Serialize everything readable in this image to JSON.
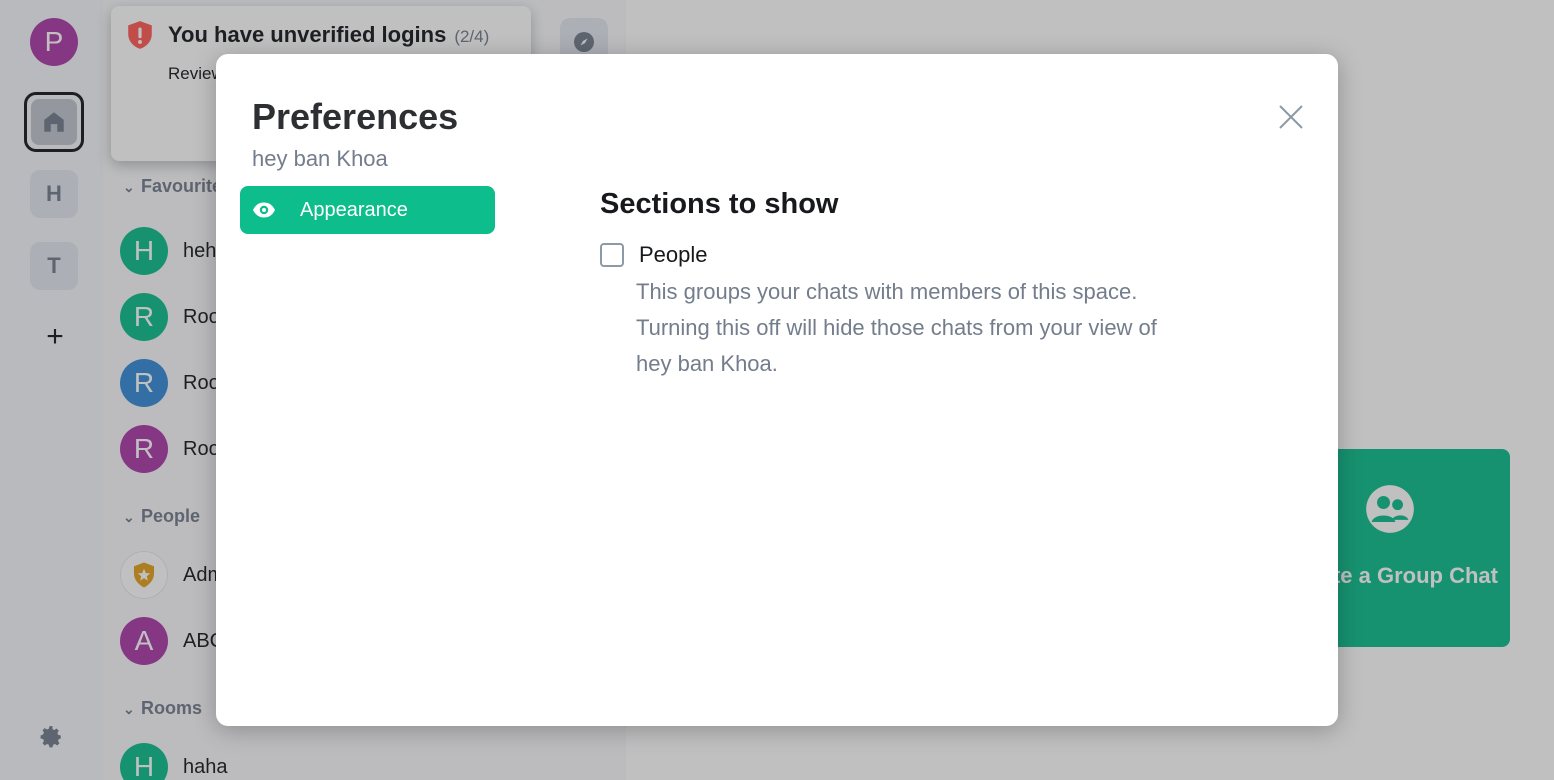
{
  "colors": {
    "accent": "#0dbd8b",
    "text_primary": "#17191c",
    "text_secondary": "#737d8c",
    "warning": "#ff5b55"
  },
  "space_bar": {
    "avatar_letter": "P",
    "home_icon": "home-icon",
    "spaces": [
      "H",
      "T"
    ],
    "add_symbol": "+",
    "settings_icon": "gear-icon"
  },
  "room_list": {
    "sections": [
      {
        "label": "Favourites",
        "rooms": [
          {
            "name": "hehe",
            "letter": "H",
            "color": "#0dbd8b"
          },
          {
            "name": "Room",
            "letter": "R",
            "color": "#0dbd8b"
          },
          {
            "name": "Room",
            "letter": "R",
            "color": "#2dc2c5"
          },
          {
            "name": "Room",
            "letter": "R",
            "color": "#ac3ba8"
          }
        ]
      },
      {
        "label": "People",
        "rooms": [
          {
            "name": "Admin",
            "letter": "",
            "color": "#fff"
          },
          {
            "name": "ABC",
            "letter": "A",
            "color": "#ac3ba8"
          }
        ]
      },
      {
        "label": "Rooms",
        "rooms": [
          {
            "name": "haha",
            "letter": "H",
            "color": "#0dbd8b"
          }
        ]
      }
    ]
  },
  "toast": {
    "title": "You have unverified logins",
    "count": "(2/4)",
    "body": "Review"
  },
  "main": {
    "create_group_label": "Create a Group Chat"
  },
  "dialog": {
    "title": "Preferences",
    "subtitle": "hey ban Khoa",
    "tabs": [
      {
        "label": "Appearance",
        "icon": "eye-icon",
        "selected": true
      }
    ],
    "section_heading": "Sections to show",
    "option": {
      "label": "People",
      "checked": false,
      "description": "This groups your chats with members of this space. Turning this off will hide those chats from your view of hey ban Khoa."
    },
    "close_icon": "close-icon"
  }
}
